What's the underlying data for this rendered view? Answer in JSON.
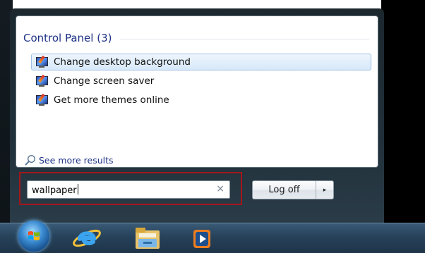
{
  "start_menu": {
    "section": {
      "title": "Control Panel (3)"
    },
    "results": [
      {
        "label": "Change desktop background",
        "icon": "display-personalize-icon",
        "selected": true
      },
      {
        "label": "Change screen saver",
        "icon": "display-personalize-icon",
        "selected": false
      },
      {
        "label": "Get more themes online",
        "icon": "display-personalize-icon",
        "selected": false
      }
    ],
    "see_more": {
      "label": "See more results",
      "icon": "magnifier-icon"
    },
    "search": {
      "value": "wallpaper",
      "clear_symbol": "×"
    },
    "power": {
      "label": "Log off",
      "arrow": "▸"
    }
  },
  "taskbar": {
    "items": [
      {
        "name": "start-orb",
        "icon": "windows-orb-icon"
      },
      {
        "name": "internet-explorer",
        "icon": "ie-icon"
      },
      {
        "name": "windows-explorer",
        "icon": "folder-icon"
      },
      {
        "name": "windows-media-player",
        "icon": "media-player-icon"
      }
    ]
  },
  "colors": {
    "highlight_outline": "#a4161a",
    "link_text": "#1e3287",
    "selected_bg": "#d6e8fa"
  }
}
